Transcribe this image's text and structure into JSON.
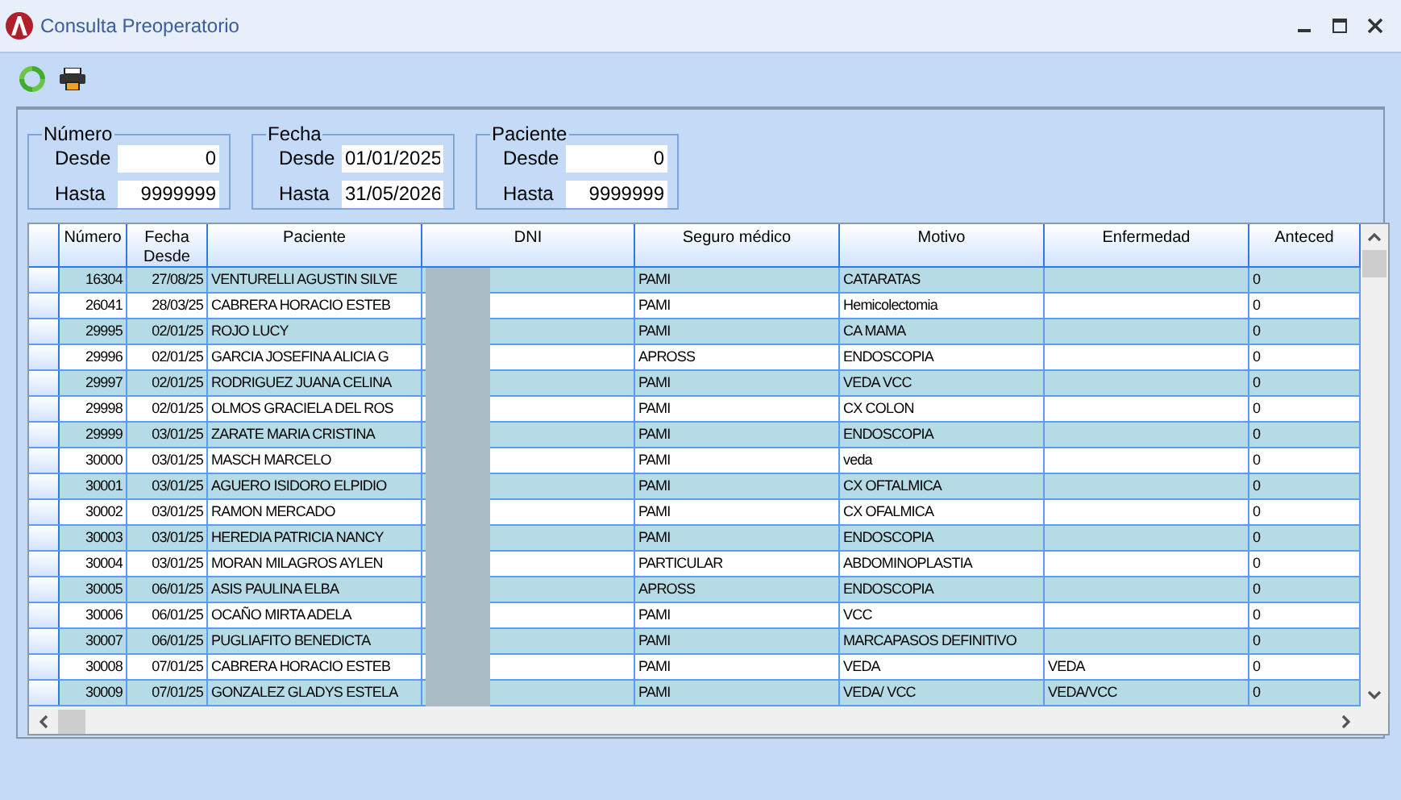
{
  "window": {
    "title": "Consulta Preoperatorio"
  },
  "filters": [
    {
      "label": "Número",
      "from_label": "Desde",
      "from": "0",
      "to_label": "Hasta",
      "to": "9999999"
    },
    {
      "label": "Fecha",
      "from_label": "Desde",
      "from": "01/01/2025",
      "to_label": "Hasta",
      "to": "31/05/2026"
    },
    {
      "label": "Paciente",
      "from_label": "Desde",
      "from": "0",
      "to_label": "Hasta",
      "to": "9999999"
    }
  ],
  "table": {
    "columns": [
      "Número",
      "Fecha Desde",
      "Paciente",
      "DNI",
      "Seguro médico",
      "Motivo",
      "Enfermedad",
      "Anteced"
    ],
    "rows": [
      {
        "numero": "16304",
        "fecha": "27/08/25",
        "paciente": "VENTURELLI AGUSTIN SILVE",
        "seguro": "PAMI",
        "motivo": "CATARATAS",
        "anteced": "0"
      },
      {
        "numero": "26041",
        "fecha": "28/03/25",
        "paciente": "CABRERA HORACIO ESTEB",
        "seguro": "PAMI",
        "motivo": "Hemicolectomia",
        "anteced": "0"
      },
      {
        "numero": "29995",
        "fecha": "02/01/25",
        "paciente": "ROJO LUCY",
        "seguro": "PAMI",
        "motivo": "CA MAMA",
        "anteced": "0"
      },
      {
        "numero": "29996",
        "fecha": "02/01/25",
        "paciente": "GARCIA JOSEFINA ALICIA G",
        "seguro": "APROSS",
        "motivo": "ENDOSCOPIA",
        "anteced": "0"
      },
      {
        "numero": "29997",
        "fecha": "02/01/25",
        "paciente": "RODRIGUEZ JUANA CELINA",
        "seguro": "PAMI",
        "motivo": "VEDA VCC",
        "anteced": "0"
      },
      {
        "numero": "29998",
        "fecha": "02/01/25",
        "paciente": "OLMOS GRACIELA DEL ROS",
        "seguro": "PAMI",
        "motivo": "CX COLON",
        "anteced": "0"
      },
      {
        "numero": "29999",
        "fecha": "03/01/25",
        "paciente": "ZARATE MARIA CRISTINA",
        "seguro": "PAMI",
        "motivo": "ENDOSCOPIA",
        "anteced": "0"
      },
      {
        "numero": "30000",
        "fecha": "03/01/25",
        "paciente": "MASCH MARCELO",
        "seguro": "PAMI",
        "motivo": "veda",
        "anteced": "0"
      },
      {
        "numero": "30001",
        "fecha": "03/01/25",
        "paciente": "AGUERO ISIDORO ELPIDIO",
        "seguro": "PAMI",
        "motivo": "CX OFTALMICA",
        "anteced": "0"
      },
      {
        "numero": "30002",
        "fecha": "03/01/25",
        "paciente": "RAMON MERCADO",
        "seguro": "PAMI",
        "motivo": "CX OFALMICA",
        "anteced": "0"
      },
      {
        "numero": "30003",
        "fecha": "03/01/25",
        "paciente": "HEREDIA PATRICIA NANCY",
        "seguro": "PAMI",
        "motivo": "ENDOSCOPIA",
        "anteced": "0"
      },
      {
        "numero": "30004",
        "fecha": "03/01/25",
        "paciente": "MORAN MILAGROS AYLEN",
        "seguro": "PARTICULAR",
        "motivo": "ABDOMINOPLASTIA",
        "anteced": "0"
      },
      {
        "numero": "30005",
        "fecha": "06/01/25",
        "paciente": "ASIS PAULINA ELBA",
        "seguro": "APROSS",
        "motivo": "ENDOSCOPIA",
        "anteced": "0"
      },
      {
        "numero": "30006",
        "fecha": "06/01/25",
        "paciente": "OCAÑO MIRTA ADELA",
        "seguro": "PAMI",
        "motivo": "VCC",
        "anteced": "0"
      },
      {
        "numero": "30007",
        "fecha": "06/01/25",
        "paciente": "PUGLIAFITO BENEDICTA",
        "seguro": "PAMI",
        "motivo": "MARCAPASOS DEFINITIVO",
        "anteced": "0"
      },
      {
        "numero": "30008",
        "fecha": "07/01/25",
        "paciente": "CABRERA HORACIO ESTEB",
        "seguro": "PAMI",
        "motivo": "VEDA",
        "enfermedad": "VEDA",
        "anteced": "0"
      },
      {
        "numero": "30009",
        "fecha": "07/01/25",
        "paciente": "GONZALEZ GLADYS ESTELA",
        "seguro": "PAMI",
        "motivo": "VEDA/ VCC",
        "enfermedad": "VEDA/VCC",
        "anteced": "0"
      }
    ]
  }
}
